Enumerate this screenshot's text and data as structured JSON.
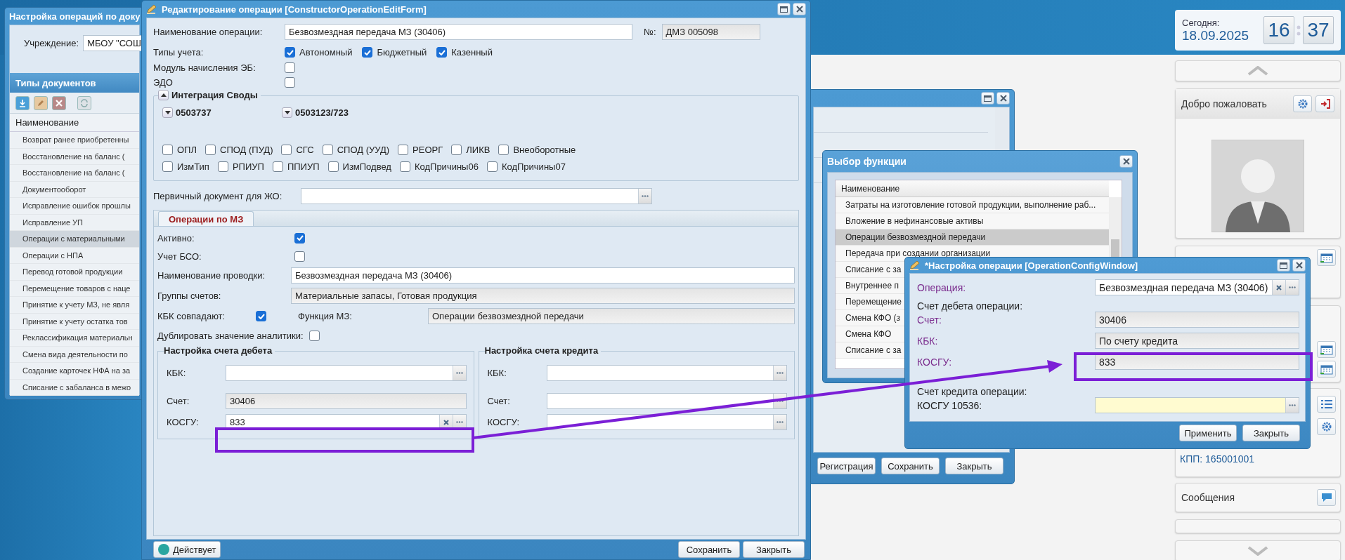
{
  "left_window": {
    "title": "Настройка операций по доку",
    "institution_label": "Учреждение:",
    "institution": "МБОУ \"СОШ",
    "panel_title": "Типы документов",
    "column": "Наименование",
    "rows": [
      {
        "text": "Возврат ранее приобретенны",
        "selected": false
      },
      {
        "text": "Восстановление на баланс (",
        "selected": false
      },
      {
        "text": "Восстановление на баланс (",
        "selected": false
      },
      {
        "text": "Документооборот",
        "selected": false
      },
      {
        "text": "Исправление ошибок прошлы",
        "selected": false
      },
      {
        "text": "Исправление УП",
        "selected": false
      },
      {
        "text": "Операции с материальными",
        "selected": true
      },
      {
        "text": "Операции с НПА",
        "selected": false
      },
      {
        "text": "Перевод готовой продукции",
        "selected": false
      },
      {
        "text": "Перемещение товаров с наце",
        "selected": false
      },
      {
        "text": "Принятие к учету МЗ, не явля",
        "selected": false
      },
      {
        "text": "Принятие к учету остатка тов",
        "selected": false
      },
      {
        "text": "Реклассификация материальн",
        "selected": false
      },
      {
        "text": "Смена вида деятельности по",
        "selected": false
      },
      {
        "text": "Создание карточек НФА на за",
        "selected": false
      },
      {
        "text": "Списание с забаланса в межо",
        "selected": false
      }
    ]
  },
  "edit_window": {
    "title": "Редактирование операции [ConstructorOperationEditForm]",
    "name_label": "Наименование операции:",
    "name": "Безвозмездная передача МЗ (30406)",
    "number_label": "№:",
    "number": "ДМЗ 005098",
    "types_label": "Типы учета:",
    "types": [
      {
        "label": "Автономный",
        "checked": true
      },
      {
        "label": "Бюджетный",
        "checked": true
      },
      {
        "label": "Казенный",
        "checked": true
      }
    ],
    "flags": [
      {
        "label": "Модуль начисления ЭБ:",
        "checked": false
      },
      {
        "label": "ЭДО",
        "checked": false
      }
    ],
    "integration": {
      "title": "Интеграция Своды",
      "expanded": true,
      "groups": [
        {
          "label": "0503737",
          "expanded": false
        },
        {
          "label": "0503123/723",
          "expanded": false
        }
      ],
      "options": [
        [
          {
            "label": "ОПЛ",
            "checked": false
          },
          {
            "label": "СПОД (ПУД)",
            "checked": false
          },
          {
            "label": "СГС",
            "checked": false
          },
          {
            "label": "СПОД (УУД)",
            "checked": false
          },
          {
            "label": "РЕОРГ",
            "checked": false
          },
          {
            "label": "ЛИКВ",
            "checked": false
          },
          {
            "label": "Внеоборотные",
            "checked": false
          }
        ],
        [
          {
            "label": "ИзмТип",
            "checked": false
          },
          {
            "label": "РПИУП",
            "checked": false
          },
          {
            "label": "ППИУП",
            "checked": false
          },
          {
            "label": "ИзмПодвед",
            "checked": false
          },
          {
            "label": "КодПричины06",
            "checked": false
          },
          {
            "label": "КодПричины07",
            "checked": false
          }
        ]
      ]
    },
    "primary_doc_label": "Первичный документ для ЖО:",
    "tabs": [
      {
        "label": "Операции по МЗ",
        "selected": true
      }
    ],
    "active_label": "Активно:",
    "active": true,
    "bso_label": "Учет БСО:",
    "bso": false,
    "posting_label": "Наименование проводки:",
    "posting": "Безвозмездная передача МЗ (30406)",
    "groups_label": "Группы счетов:",
    "groups": "Материальные запасы, Готовая продукция",
    "kbk_match_label": "КБК совпадают:",
    "kbk_match": true,
    "function_label": "Функция МЗ:",
    "function": "Операции безвозмездной передачи",
    "duplicate_label": "Дублировать значение аналитики:",
    "duplicate": false,
    "accounts": [
      {
        "title": "Настройка счета дебета",
        "fields": [
          {
            "label": "КБК:",
            "kind": "lookup"
          },
          {
            "label": "Счет:",
            "kind": "readonly",
            "value": "30406"
          },
          {
            "label": "КОСГУ:",
            "kind": "clearable",
            "value": "833"
          }
        ]
      },
      {
        "title": "Настройка счета кредита",
        "fields": [
          {
            "label": "КБК:",
            "kind": "lookup"
          },
          {
            "label": "Счет:",
            "kind": "lookup"
          },
          {
            "label": "КОСГУ:",
            "kind": "lookup"
          }
        ]
      }
    ],
    "status_button": "Действует",
    "buttons": [
      "Сохранить",
      "Закрыть"
    ]
  },
  "back_window": {
    "buttons": [
      "Регистрация",
      "Сохранить",
      "Закрыть"
    ]
  },
  "function_window": {
    "title": "Выбор функции",
    "column": "Наименование",
    "rows": [
      {
        "text": "Затраты на изготовление готовой продукции, выполнение раб...",
        "selected": false
      },
      {
        "text": "Вложение в нефинансовые активы",
        "selected": false
      },
      {
        "text": "Операции безвозмездной передачи",
        "selected": true
      },
      {
        "text": "Передача при создании организации",
        "selected": false
      },
      {
        "text": "Списание с за",
        "selected": false
      },
      {
        "text": "Внутреннее п",
        "selected": false
      },
      {
        "text": "Перемещение",
        "selected": false
      },
      {
        "text": "Смена КФО (з",
        "selected": false
      },
      {
        "text": "Смена КФО",
        "selected": false
      },
      {
        "text": "Списание с за",
        "selected": false
      }
    ]
  },
  "config_window": {
    "title": "*Настройка операции [OperationConfigWindow]",
    "rows": [
      {
        "kind": "clearable",
        "label": "Операция:",
        "accent": true,
        "value": "Безвозмездная передача МЗ (30406)"
      },
      {
        "kind": "section",
        "label": "Счет дебета операции:"
      },
      {
        "kind": "readonly",
        "label": "Счет:",
        "accent": true,
        "value": "30406"
      },
      {
        "kind": "readonly",
        "label": "КБК:",
        "accent": true,
        "value": "По счету кредита"
      },
      {
        "kind": "readonly",
        "label": "КОСГУ:",
        "accent": true,
        "value": "833"
      },
      {
        "kind": "section",
        "label": "Счет кредита операции:"
      },
      {
        "kind": "required",
        "label": "КОСГУ 10536:",
        "accent": false
      }
    ],
    "buttons": [
      "Применить",
      "Закрыть"
    ]
  },
  "sidebar": {
    "today_label": "Сегодня:",
    "date": "18.09.2025",
    "hours": "16",
    "minutes": "37",
    "welcome": "Добро пожаловать",
    "kpp": "КПП: 165001001",
    "messages": "Сообщения"
  }
}
